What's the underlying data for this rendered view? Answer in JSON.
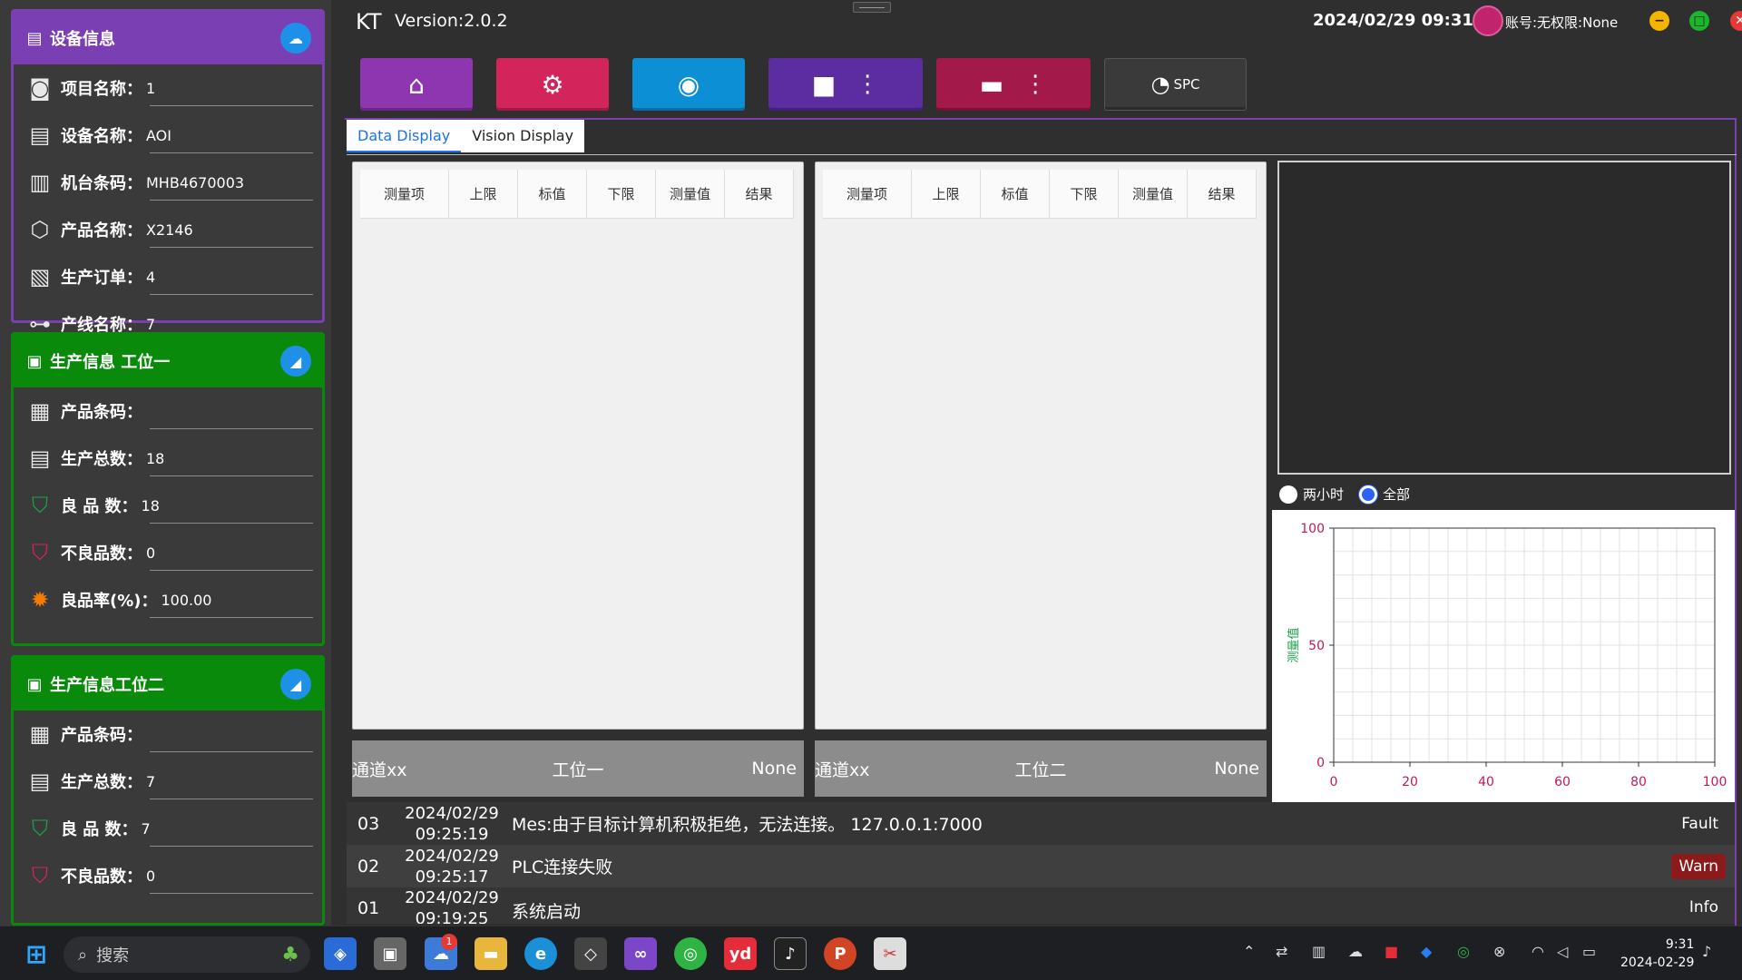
{
  "app": {
    "name": "KT",
    "version": "Version:2.0.2"
  },
  "header": {
    "datetime": "2024/02/29  09:31",
    "account": "账号:无权限:None"
  },
  "device_info": {
    "title": "设备信息",
    "rows": [
      {
        "label": "项目名称：",
        "value": "1"
      },
      {
        "label": "设备名称：",
        "value": "AOI"
      },
      {
        "label": "机台条码：",
        "value": "MHB4670003"
      },
      {
        "label": "产品名称：",
        "value": "X2146"
      },
      {
        "label": "生产订单：",
        "value": "4"
      },
      {
        "label": "产线名称：",
        "value": "7"
      }
    ]
  },
  "prod1": {
    "title": "生产信息 工位一",
    "rows": [
      {
        "label": "产品条码：",
        "value": ""
      },
      {
        "label": "生产总数：",
        "value": "18"
      },
      {
        "label": "良  品  数：",
        "value": "18"
      },
      {
        "label": "不良品数：",
        "value": "0"
      },
      {
        "label": "良品率(%)：",
        "value": "100.00"
      }
    ]
  },
  "prod2": {
    "title": "生产信息工位二",
    "rows": [
      {
        "label": "产品条码：",
        "value": ""
      },
      {
        "label": "生产总数：",
        "value": "7"
      },
      {
        "label": "良  品  数：",
        "value": "7"
      },
      {
        "label": "不良品数：",
        "value": "0"
      }
    ]
  },
  "toolbar": {
    "spc_label": "SPC"
  },
  "tabs": [
    "Data Display",
    "Vision Display"
  ],
  "table": {
    "headers": [
      "测量项",
      "上限",
      "标值",
      "下限",
      "测量值",
      "结果"
    ]
  },
  "station1": {
    "channel": "通道xx",
    "name": "工位一",
    "status": "None"
  },
  "station2": {
    "channel": "通道xx",
    "name": "工位二",
    "status": "None"
  },
  "radios": {
    "two_hours": "两小时",
    "all": "全部"
  },
  "chart_data": {
    "type": "line",
    "ylabel": "测量值",
    "xlim": [
      0,
      100
    ],
    "ylim": [
      0,
      100
    ],
    "xticks": [
      "0",
      "20",
      "40",
      "60",
      "80",
      "100"
    ],
    "yticks": [
      "0",
      "50",
      "100"
    ],
    "series": [],
    "grid": true
  },
  "log": [
    {
      "id": "03",
      "date": "2024/02/29",
      "time": "09:25:19",
      "msg": "Mes:由于目标计算机积极拒绝，无法连接。 127.0.0.1:7000",
      "level": "Fault"
    },
    {
      "id": "02",
      "date": "2024/02/29",
      "time": "09:25:17",
      "msg": "PLC连接失败",
      "level": "Warn"
    },
    {
      "id": "01",
      "date": "2024/02/29",
      "time": "09:19:25",
      "msg": "系统启动",
      "level": "Info"
    }
  ],
  "taskbar": {
    "search": "搜索",
    "time": "9:31",
    "date": "2024-02-29",
    "badge": "1"
  },
  "colors": {
    "purple": "#7b3fb4",
    "green": "#0a8a0a",
    "pink": "#d4245c",
    "blue": "#1e90e8",
    "warn": "#8b1a1a"
  }
}
